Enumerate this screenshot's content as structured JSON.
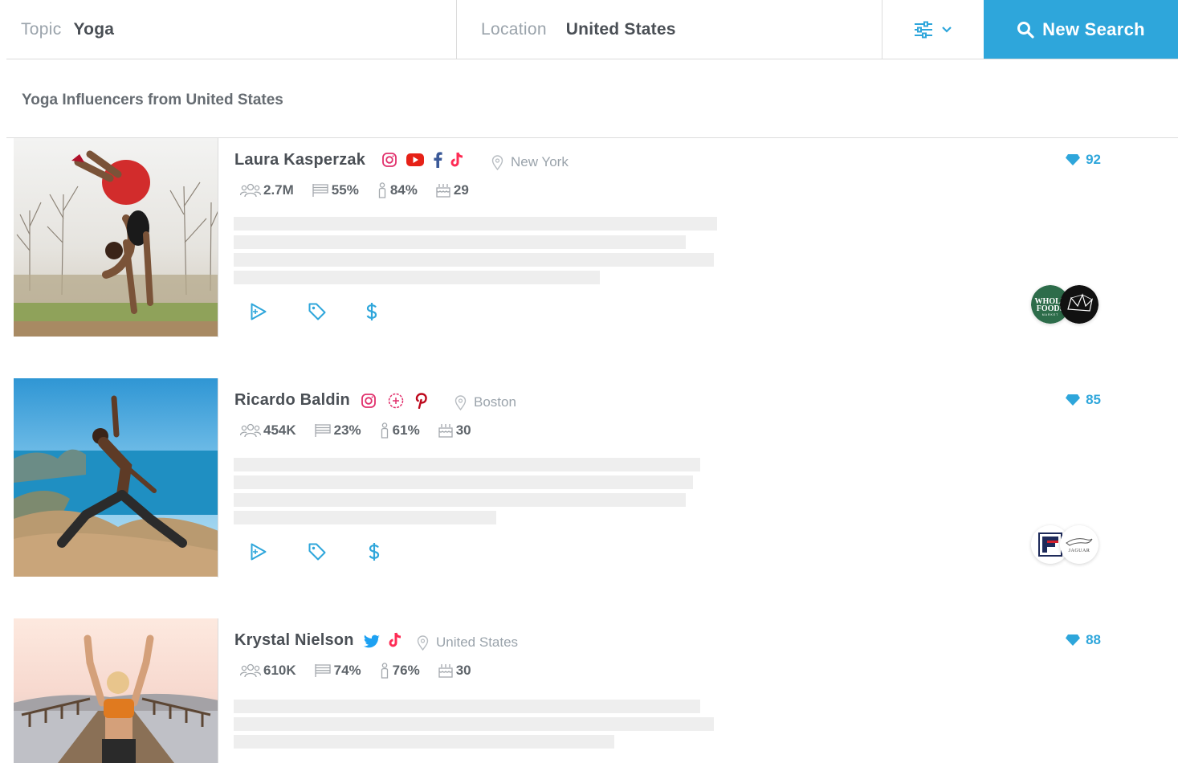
{
  "search": {
    "topic_label": "Topic",
    "topic_value": "Yoga",
    "location_label": "Location",
    "location_value": "United States",
    "new_search_label": "New Search"
  },
  "results_title": "Yoga Influencers from United States",
  "influencers": [
    {
      "name": "Laura Kasperzak",
      "socials": [
        "instagram-icon",
        "youtube-icon",
        "facebook-icon",
        "tiktok-icon"
      ],
      "location": "New York",
      "followers": "2.7M",
      "country_share": "55%",
      "gender_share": "84%",
      "age": "29",
      "score": "92",
      "brands": [
        "Whole Foods Market",
        "crown-logo"
      ]
    },
    {
      "name": "Ricardo Baldin",
      "socials": [
        "instagram-icon",
        "instagram-plus-icon",
        "pinterest-icon"
      ],
      "location": "Boston",
      "followers": "454K",
      "country_share": "23%",
      "gender_share": "61%",
      "age": "30",
      "score": "85",
      "brands": [
        "FILA",
        "Jaguar"
      ]
    },
    {
      "name": "Krystal Nielson",
      "socials": [
        "twitter-icon",
        "tiktok-icon"
      ],
      "location": "United States",
      "followers": "610K",
      "country_share": "74%",
      "gender_share": "76%",
      "age": "30",
      "score": "88",
      "brands": []
    }
  ],
  "colors": {
    "accent": "#2ea6db",
    "skeleton": "#eeeeee",
    "instagram": "#e1306c",
    "youtube": "#e62117",
    "facebook": "#3b5998",
    "tiktok": "#fe2c55",
    "pinterest": "#bd081c",
    "twitter": "#1da1f2"
  }
}
